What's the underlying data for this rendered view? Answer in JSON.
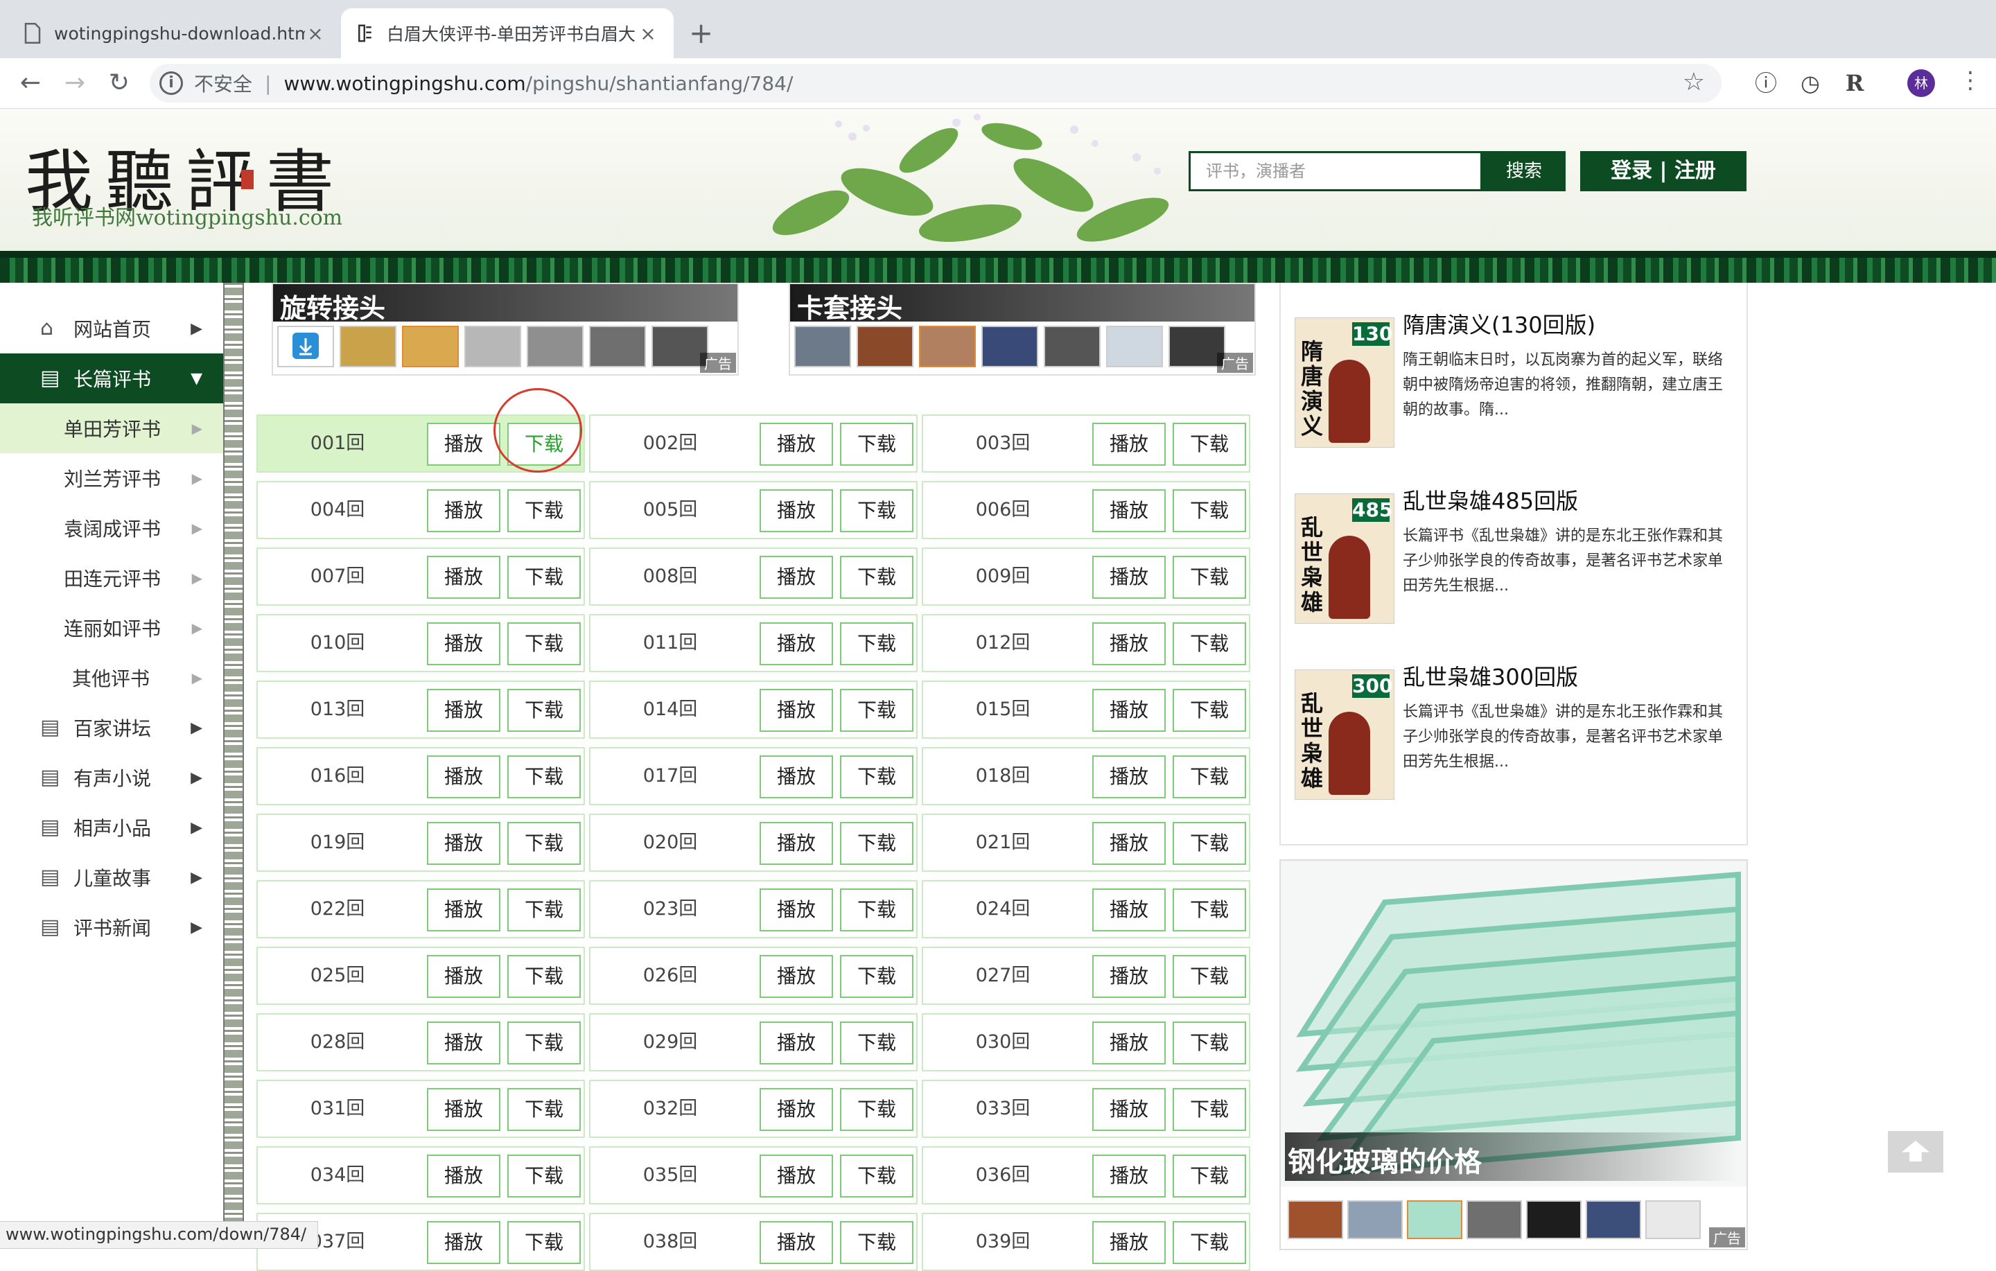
{
  "browser": {
    "tabs": [
      {
        "title": "wotingpingshu-download.html",
        "close": "×"
      },
      {
        "title": "白眉大侠评书-单田芳评书白眉大",
        "close": "×"
      }
    ],
    "new_tab": "+",
    "nav": {
      "back": "←",
      "forward": "→",
      "reload": "↻"
    },
    "address": {
      "insecure": "不安全",
      "separator": "|",
      "host": "www.wotingpingshu.com",
      "path": "/pingshu/shantianfang/784/"
    },
    "star": "☆",
    "extensions": {
      "e1": "ⓘ",
      "e2": "◷",
      "e3": "R"
    },
    "avatar": "林",
    "menu": "⋮",
    "status_url": "www.wotingpingshu.com/down/784/"
  },
  "site": {
    "logo_main": "我聽評書",
    "logo_sub": "我听评书网wotingpingshu.com",
    "search_placeholder": "评书，演播者",
    "search_button": "搜索",
    "login": "登录 | 注册"
  },
  "sidebar": {
    "items": [
      {
        "label": "网站首页",
        "icon": "home-icon",
        "glyph": "⌂"
      },
      {
        "label": "长篇评书",
        "icon": "book-icon",
        "glyph": "▤"
      }
    ],
    "sub_items": [
      "单田芳评书",
      "刘兰芳评书",
      "袁阔成评书",
      "田连元评书",
      "连丽如评书",
      "其他评书"
    ],
    "more_items": [
      "百家讲坛",
      "有声小说",
      "相声小品",
      "儿童故事",
      "评书新闻"
    ]
  },
  "ads": {
    "ad1_title": "旋转接头",
    "ad2_title": "卡套接头",
    "ad_label": "广告"
  },
  "episodes": {
    "play_label": "播放",
    "download_label": "下载",
    "list": [
      "001回",
      "002回",
      "003回",
      "004回",
      "005回",
      "006回",
      "007回",
      "008回",
      "009回",
      "010回",
      "011回",
      "012回",
      "013回",
      "014回",
      "015回",
      "016回",
      "017回",
      "018回",
      "019回",
      "020回",
      "021回",
      "022回",
      "023回",
      "024回",
      "025回",
      "026回",
      "027回",
      "028回",
      "029回",
      "030回",
      "031回",
      "032回",
      "033回",
      "034回",
      "035回",
      "036回",
      "037回",
      "038回",
      "039回"
    ],
    "highlighted": "001回"
  },
  "recommend": [
    {
      "title": "隋唐演义(130回版)",
      "badge": "130",
      "cover_text": "隋唐演义",
      "desc": "隋王朝临末日时，以瓦岗寨为首的起义军，联络朝中被隋炀帝迫害的将领，推翻隋朝，建立唐王朝的故事。隋..."
    },
    {
      "title": "乱世枭雄485回版",
      "badge": "485",
      "cover_text": "乱世枭雄",
      "desc": "长篇评书《乱世枭雄》讲的是东北王张作霖和其子少帅张学良的传奇故事，是著名评书艺术家单田芳先生根据..."
    },
    {
      "title": "乱世枭雄300回版",
      "badge": "300",
      "cover_text": "乱世枭雄",
      "desc": "长篇评书《乱世枭雄》讲的是东北王张作霖和其子少帅张学良的传奇故事，是著名评书艺术家单田芳先生根据..."
    }
  ],
  "glass_ad": {
    "title": "钢化玻璃的价格",
    "label": "广告"
  },
  "colors": {
    "brand_green": "#0d4b22",
    "highlight": "#d8f3c8",
    "circle": "#d83a2f"
  }
}
